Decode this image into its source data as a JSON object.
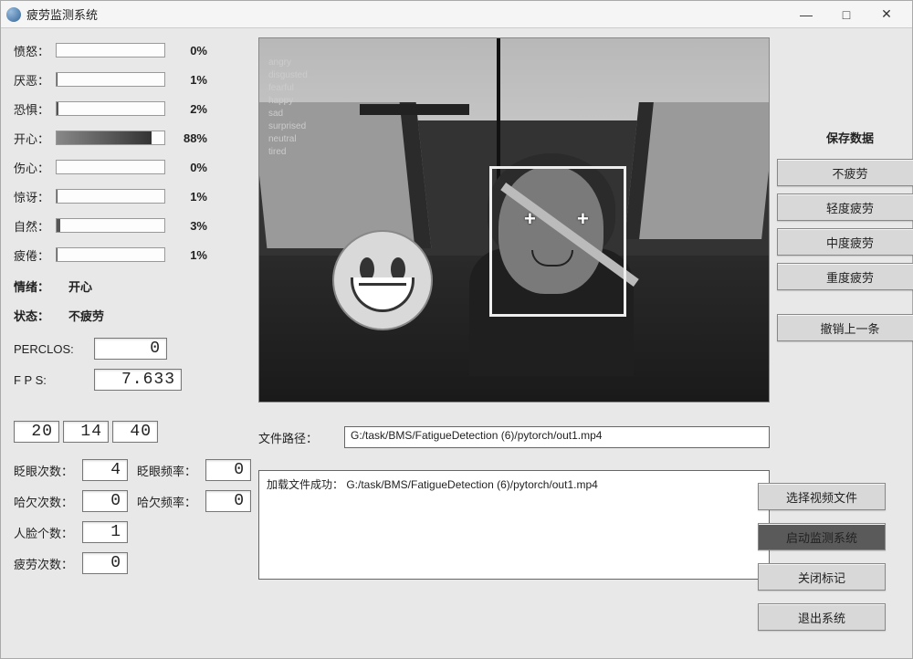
{
  "window": {
    "title": "疲劳监测系统",
    "minimize": "—",
    "maximize": "□",
    "close": "✕"
  },
  "emotions": {
    "items": [
      {
        "label": "愤怒：",
        "pct": 0,
        "pct_text": "0%"
      },
      {
        "label": "厌恶：",
        "pct": 1,
        "pct_text": "1%"
      },
      {
        "label": "恐惧：",
        "pct": 2,
        "pct_text": "2%"
      },
      {
        "label": "开心：",
        "pct": 88,
        "pct_text": "88%"
      },
      {
        "label": "伤心：",
        "pct": 0,
        "pct_text": "0%"
      },
      {
        "label": "惊讶：",
        "pct": 1,
        "pct_text": "1%"
      },
      {
        "label": "自然：",
        "pct": 3,
        "pct_text": "3%"
      },
      {
        "label": "疲倦：",
        "pct": 1,
        "pct_text": "1%"
      }
    ]
  },
  "summary": {
    "mood_label": "情绪：",
    "mood_value": "开心",
    "state_label": "状态：",
    "state_value": "不疲劳"
  },
  "metrics": {
    "perclos_label": "PERCLOS:",
    "perclos_value": "0",
    "fps_label": "F P S:",
    "fps_value": "7.633"
  },
  "time": {
    "h": "20",
    "m": "14",
    "s": "40"
  },
  "stats": {
    "blink_count_label": "眨眼次数：",
    "blink_count": "4",
    "blink_rate_label": "眨眼频率：",
    "blink_rate": "0",
    "yawn_count_label": "哈欠次数：",
    "yawn_count": "0",
    "yawn_rate_label": "哈欠频率：",
    "yawn_rate": "0",
    "face_count_label": "人脸个数：",
    "face_count": "1",
    "fatigue_count_label": "疲劳次数：",
    "fatigue_count": "0"
  },
  "overlay": {
    "items": [
      "angry",
      "disgusted",
      "fearful",
      "happy",
      "sad",
      "surprised",
      "neutral",
      "tired"
    ]
  },
  "path": {
    "label": "文件路径：",
    "value": "G:/task/BMS/FatigueDetection (6)/pytorch/out1.mp4"
  },
  "log": {
    "text": "加载文件成功： G:/task/BMS/FatigueDetection (6)/pytorch/out1.mp4"
  },
  "right": {
    "save_header": "保存数据",
    "btn_none": "不疲劳",
    "btn_light": "轻度疲劳",
    "btn_mid": "中度疲劳",
    "btn_heavy": "重度疲劳",
    "btn_undo": "撤销上一条"
  },
  "actions": {
    "select_video": "选择视频文件",
    "start_system": "启动监测系统",
    "close_mark": "关闭标记",
    "exit_system": "退出系统"
  }
}
